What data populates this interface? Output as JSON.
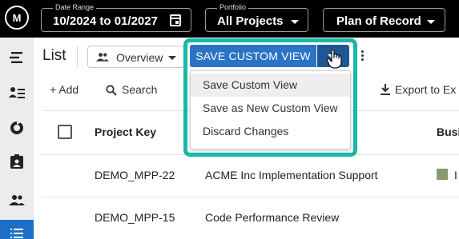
{
  "topbar": {
    "logo_text": "M",
    "date_range": {
      "label": "Date Range",
      "value": "10/2024 to 01/2027"
    },
    "portfolio": {
      "label": "Portfolio",
      "value": "All Projects"
    },
    "plan": {
      "value": "Plan of Record"
    }
  },
  "page": {
    "title": "List",
    "view_select": "Overview"
  },
  "save_view": {
    "button_label": "SAVE CUSTOM VIEW",
    "menu": [
      "Save Custom View",
      "Save as New Custom View",
      "Discard Changes"
    ],
    "hovered_index": 0
  },
  "toolbar": {
    "add": "+ Add",
    "search": "Search",
    "export": "Export to Ex"
  },
  "table": {
    "columns": [
      "Project Key",
      "Busi"
    ],
    "rows": [
      {
        "key": "DEMO_MPP-22",
        "name": "ACME Inc Implementation Support",
        "business": "I"
      },
      {
        "key": "DEMO_MPP-15",
        "name": "Code Performance Review",
        "business": ""
      }
    ]
  },
  "colors": {
    "topbar": "#000000",
    "accent": "#2b73c4",
    "highlight": "#18b8a8",
    "swatch": "#8a9a6f"
  }
}
